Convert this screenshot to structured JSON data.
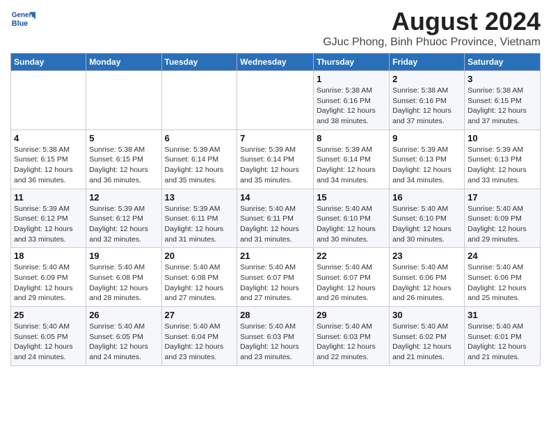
{
  "logo": {
    "line1": "General",
    "line2": "Blue"
  },
  "title": "August 2024",
  "subtitle": "GJuc Phong, Binh Phuoc Province, Vietnam",
  "weekdays": [
    "Sunday",
    "Monday",
    "Tuesday",
    "Wednesday",
    "Thursday",
    "Friday",
    "Saturday"
  ],
  "weeks": [
    [
      {
        "day": "",
        "info": ""
      },
      {
        "day": "",
        "info": ""
      },
      {
        "day": "",
        "info": ""
      },
      {
        "day": "",
        "info": ""
      },
      {
        "day": "1",
        "info": "Sunrise: 5:38 AM\nSunset: 6:16 PM\nDaylight: 12 hours\nand 38 minutes."
      },
      {
        "day": "2",
        "info": "Sunrise: 5:38 AM\nSunset: 6:16 PM\nDaylight: 12 hours\nand 37 minutes."
      },
      {
        "day": "3",
        "info": "Sunrise: 5:38 AM\nSunset: 6:15 PM\nDaylight: 12 hours\nand 37 minutes."
      }
    ],
    [
      {
        "day": "4",
        "info": "Sunrise: 5:38 AM\nSunset: 6:15 PM\nDaylight: 12 hours\nand 36 minutes."
      },
      {
        "day": "5",
        "info": "Sunrise: 5:38 AM\nSunset: 6:15 PM\nDaylight: 12 hours\nand 36 minutes."
      },
      {
        "day": "6",
        "info": "Sunrise: 5:39 AM\nSunset: 6:14 PM\nDaylight: 12 hours\nand 35 minutes."
      },
      {
        "day": "7",
        "info": "Sunrise: 5:39 AM\nSunset: 6:14 PM\nDaylight: 12 hours\nand 35 minutes."
      },
      {
        "day": "8",
        "info": "Sunrise: 5:39 AM\nSunset: 6:14 PM\nDaylight: 12 hours\nand 34 minutes."
      },
      {
        "day": "9",
        "info": "Sunrise: 5:39 AM\nSunset: 6:13 PM\nDaylight: 12 hours\nand 34 minutes."
      },
      {
        "day": "10",
        "info": "Sunrise: 5:39 AM\nSunset: 6:13 PM\nDaylight: 12 hours\nand 33 minutes."
      }
    ],
    [
      {
        "day": "11",
        "info": "Sunrise: 5:39 AM\nSunset: 6:12 PM\nDaylight: 12 hours\nand 33 minutes."
      },
      {
        "day": "12",
        "info": "Sunrise: 5:39 AM\nSunset: 6:12 PM\nDaylight: 12 hours\nand 32 minutes."
      },
      {
        "day": "13",
        "info": "Sunrise: 5:39 AM\nSunset: 6:11 PM\nDaylight: 12 hours\nand 31 minutes."
      },
      {
        "day": "14",
        "info": "Sunrise: 5:40 AM\nSunset: 6:11 PM\nDaylight: 12 hours\nand 31 minutes."
      },
      {
        "day": "15",
        "info": "Sunrise: 5:40 AM\nSunset: 6:10 PM\nDaylight: 12 hours\nand 30 minutes."
      },
      {
        "day": "16",
        "info": "Sunrise: 5:40 AM\nSunset: 6:10 PM\nDaylight: 12 hours\nand 30 minutes."
      },
      {
        "day": "17",
        "info": "Sunrise: 5:40 AM\nSunset: 6:09 PM\nDaylight: 12 hours\nand 29 minutes."
      }
    ],
    [
      {
        "day": "18",
        "info": "Sunrise: 5:40 AM\nSunset: 6:09 PM\nDaylight: 12 hours\nand 29 minutes."
      },
      {
        "day": "19",
        "info": "Sunrise: 5:40 AM\nSunset: 6:08 PM\nDaylight: 12 hours\nand 28 minutes."
      },
      {
        "day": "20",
        "info": "Sunrise: 5:40 AM\nSunset: 6:08 PM\nDaylight: 12 hours\nand 27 minutes."
      },
      {
        "day": "21",
        "info": "Sunrise: 5:40 AM\nSunset: 6:07 PM\nDaylight: 12 hours\nand 27 minutes."
      },
      {
        "day": "22",
        "info": "Sunrise: 5:40 AM\nSunset: 6:07 PM\nDaylight: 12 hours\nand 26 minutes."
      },
      {
        "day": "23",
        "info": "Sunrise: 5:40 AM\nSunset: 6:06 PM\nDaylight: 12 hours\nand 26 minutes."
      },
      {
        "day": "24",
        "info": "Sunrise: 5:40 AM\nSunset: 6:06 PM\nDaylight: 12 hours\nand 25 minutes."
      }
    ],
    [
      {
        "day": "25",
        "info": "Sunrise: 5:40 AM\nSunset: 6:05 PM\nDaylight: 12 hours\nand 24 minutes."
      },
      {
        "day": "26",
        "info": "Sunrise: 5:40 AM\nSunset: 6:05 PM\nDaylight: 12 hours\nand 24 minutes."
      },
      {
        "day": "27",
        "info": "Sunrise: 5:40 AM\nSunset: 6:04 PM\nDaylight: 12 hours\nand 23 minutes."
      },
      {
        "day": "28",
        "info": "Sunrise: 5:40 AM\nSunset: 6:03 PM\nDaylight: 12 hours\nand 23 minutes."
      },
      {
        "day": "29",
        "info": "Sunrise: 5:40 AM\nSunset: 6:03 PM\nDaylight: 12 hours\nand 22 minutes."
      },
      {
        "day": "30",
        "info": "Sunrise: 5:40 AM\nSunset: 6:02 PM\nDaylight: 12 hours\nand 21 minutes."
      },
      {
        "day": "31",
        "info": "Sunrise: 5:40 AM\nSunset: 6:01 PM\nDaylight: 12 hours\nand 21 minutes."
      }
    ]
  ]
}
